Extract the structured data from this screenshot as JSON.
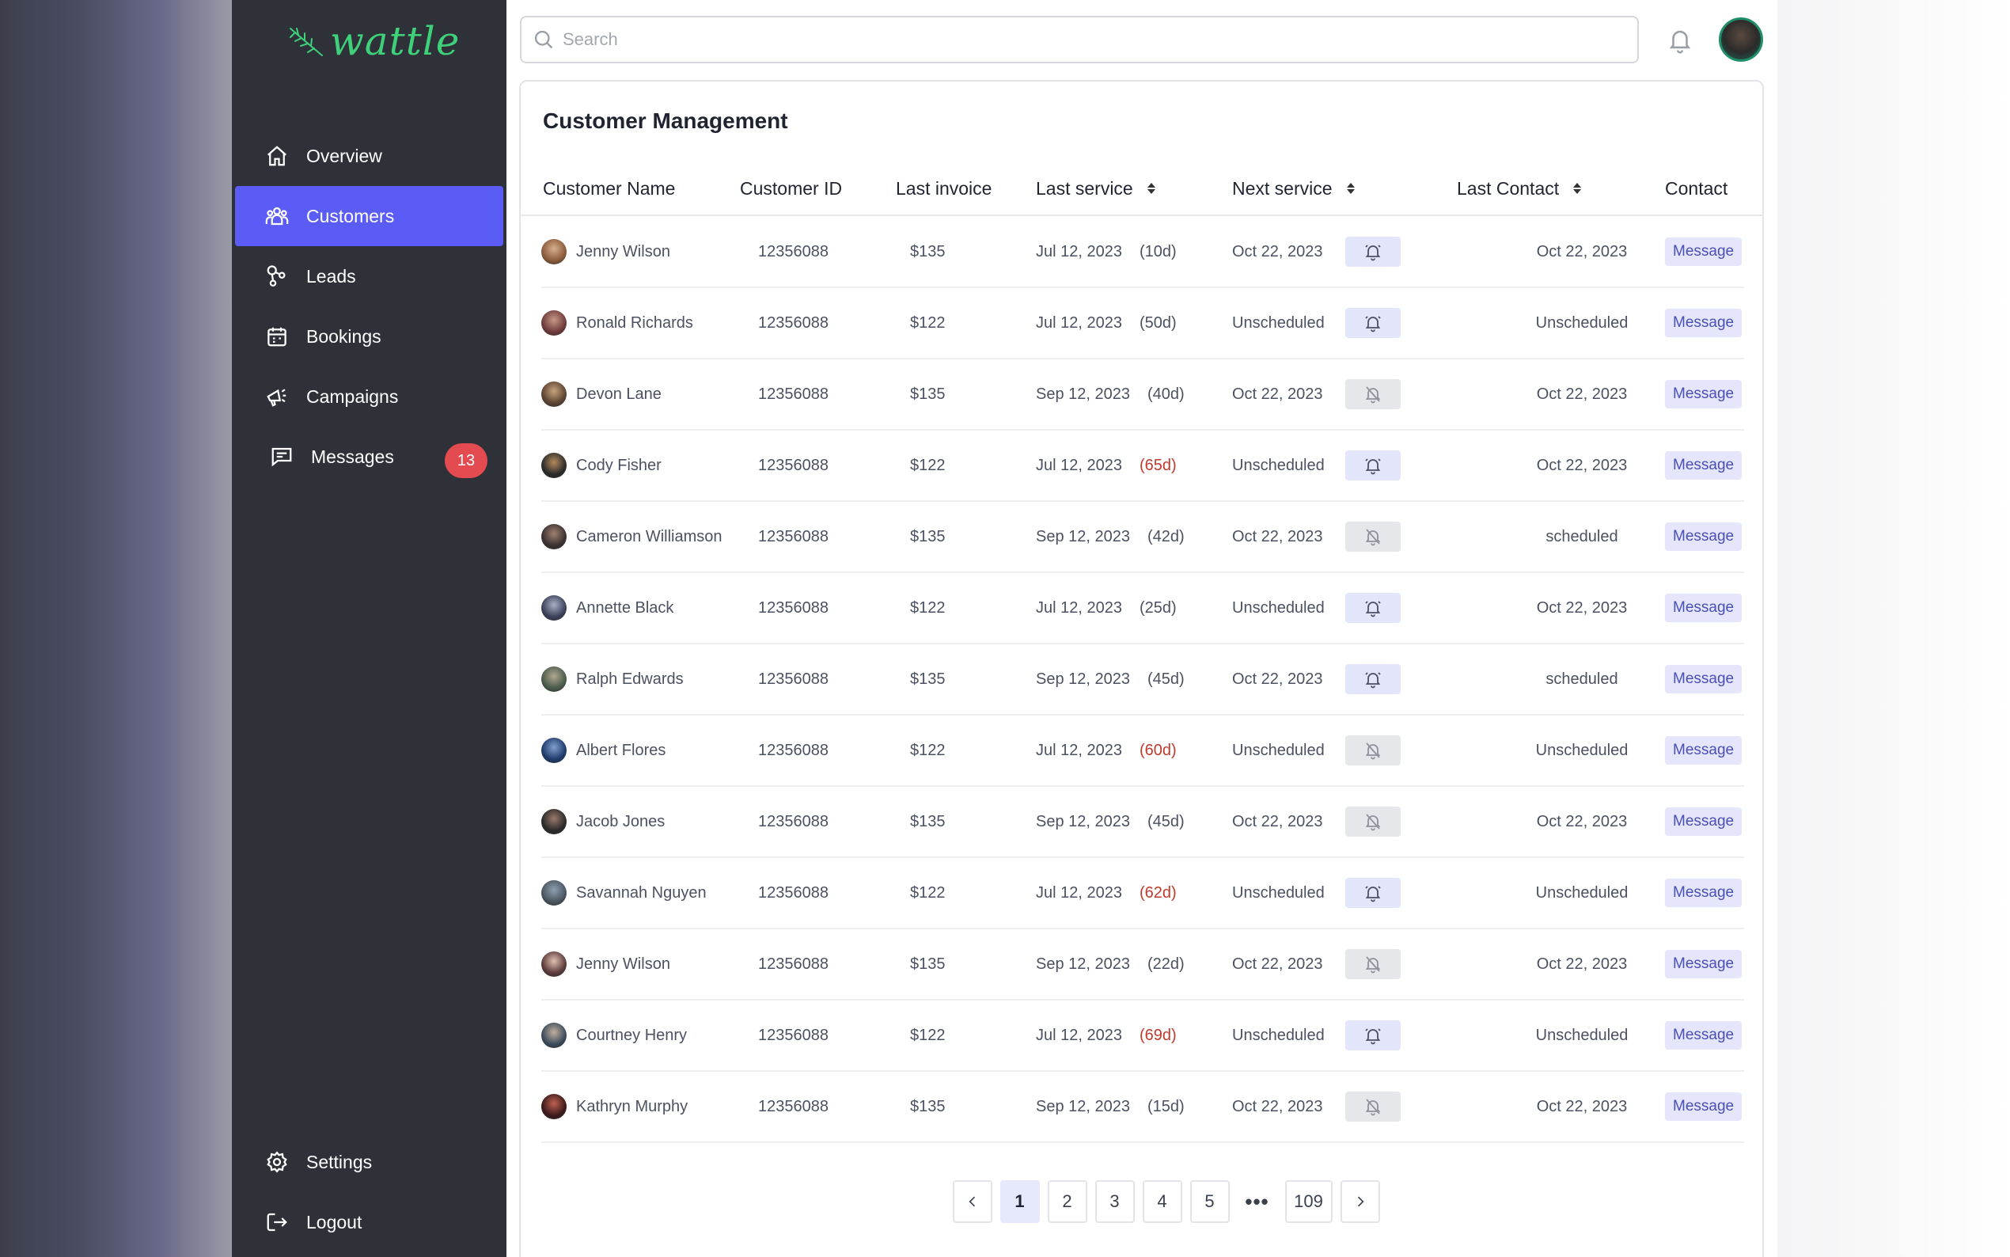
{
  "app": {
    "brand": "wattle",
    "accent": "#5b5cf5"
  },
  "sidebar": {
    "items": [
      {
        "label": "Overview",
        "icon": "home-icon"
      },
      {
        "label": "Customers",
        "icon": "users-icon",
        "active": true
      },
      {
        "label": "Leads",
        "icon": "leads-icon"
      },
      {
        "label": "Bookings",
        "icon": "calendar-icon"
      },
      {
        "label": "Campaigns",
        "icon": "megaphone-icon"
      },
      {
        "label": "Messages",
        "icon": "chat-icon",
        "badge": "13"
      }
    ],
    "bottom": [
      {
        "label": "Settings",
        "icon": "gear-icon"
      },
      {
        "label": "Logout",
        "icon": "logout-icon"
      }
    ]
  },
  "topbar": {
    "search_placeholder": "Search"
  },
  "main": {
    "title": "Customer Management",
    "columns": [
      "Customer Name",
      "Customer ID",
      "Last invoice",
      "Last service",
      "Next service",
      "Last Contact",
      "Contact"
    ],
    "rows": [
      {
        "name": "Jenny Wilson",
        "id": "12356088",
        "invoice": "$135",
        "last_service": "Jul 12, 2023",
        "days": "(10d)",
        "overdue": false,
        "next_service": "Oct 22, 2023",
        "reminder": "on",
        "last_contact": "Oct 22, 2023",
        "action": "Message"
      },
      {
        "name": "Ronald Richards",
        "id": "12356088",
        "invoice": "$122",
        "last_service": "Jul 12, 2023",
        "days": "(50d)",
        "overdue": false,
        "next_service": "Unscheduled",
        "reminder": "on",
        "last_contact": "Unscheduled",
        "action": "Message"
      },
      {
        "name": "Devon Lane",
        "id": "12356088",
        "invoice": "$135",
        "last_service": "Sep 12, 2023",
        "days": "(40d)",
        "overdue": false,
        "next_service": "Oct 22, 2023",
        "reminder": "off",
        "last_contact": "Oct 22, 2023",
        "action": "Message"
      },
      {
        "name": "Cody Fisher",
        "id": "12356088",
        "invoice": "$122",
        "last_service": "Jul 12, 2023",
        "days": "(65d)",
        "overdue": true,
        "next_service": "Unscheduled",
        "reminder": "on",
        "last_contact": "Oct 22, 2023",
        "action": "Message"
      },
      {
        "name": "Cameron Williamson",
        "id": "12356088",
        "invoice": "$135",
        "last_service": "Sep 12, 2023",
        "days": "(42d)",
        "overdue": false,
        "next_service": "Oct 22, 2023",
        "reminder": "off",
        "last_contact": "scheduled",
        "action": "Message"
      },
      {
        "name": "Annette Black",
        "id": "12356088",
        "invoice": "$122",
        "last_service": "Jul 12, 2023",
        "days": "(25d)",
        "overdue": false,
        "next_service": "Unscheduled",
        "reminder": "on",
        "last_contact": "Oct 22, 2023",
        "action": "Message"
      },
      {
        "name": "Ralph Edwards",
        "id": "12356088",
        "invoice": "$135",
        "last_service": "Sep 12, 2023",
        "days": "(45d)",
        "overdue": false,
        "next_service": "Oct 22, 2023",
        "reminder": "on",
        "last_contact": "scheduled",
        "action": "Message"
      },
      {
        "name": "Albert Flores",
        "id": "12356088",
        "invoice": "$122",
        "last_service": "Jul 12, 2023",
        "days": "(60d)",
        "overdue": true,
        "next_service": "Unscheduled",
        "reminder": "off",
        "last_contact": "Unscheduled",
        "action": "Message"
      },
      {
        "name": "Jacob Jones",
        "id": "12356088",
        "invoice": "$135",
        "last_service": "Sep 12, 2023",
        "days": "(45d)",
        "overdue": false,
        "next_service": "Oct 22, 2023",
        "reminder": "off",
        "last_contact": "Oct 22, 2023",
        "action": "Message"
      },
      {
        "name": "Savannah Nguyen",
        "id": "12356088",
        "invoice": "$122",
        "last_service": "Jul 12, 2023",
        "days": "(62d)",
        "overdue": true,
        "next_service": "Unscheduled",
        "reminder": "on",
        "last_contact": "Unscheduled",
        "action": "Message"
      },
      {
        "name": "Jenny Wilson",
        "id": "12356088",
        "invoice": "$135",
        "last_service": "Sep 12, 2023",
        "days": "(22d)",
        "overdue": false,
        "next_service": "Oct 22, 2023",
        "reminder": "off",
        "last_contact": "Oct 22, 2023",
        "action": "Message"
      },
      {
        "name": "Courtney Henry",
        "id": "12356088",
        "invoice": "$122",
        "last_service": "Jul 12, 2023",
        "days": "(69d)",
        "overdue": true,
        "next_service": "Unscheduled",
        "reminder": "on",
        "last_contact": "Unscheduled",
        "action": "Message"
      },
      {
        "name": "Kathryn Murphy",
        "id": "12356088",
        "invoice": "$135",
        "last_service": "Sep 12, 2023",
        "days": "(15d)",
        "overdue": false,
        "next_service": "Oct 22, 2023",
        "reminder": "off",
        "last_contact": "Oct 22, 2023",
        "action": "Message"
      }
    ]
  },
  "pagination": {
    "pages": [
      "1",
      "2",
      "3",
      "4",
      "5"
    ],
    "ellipsis": "•••",
    "last": "109",
    "current": "1"
  }
}
